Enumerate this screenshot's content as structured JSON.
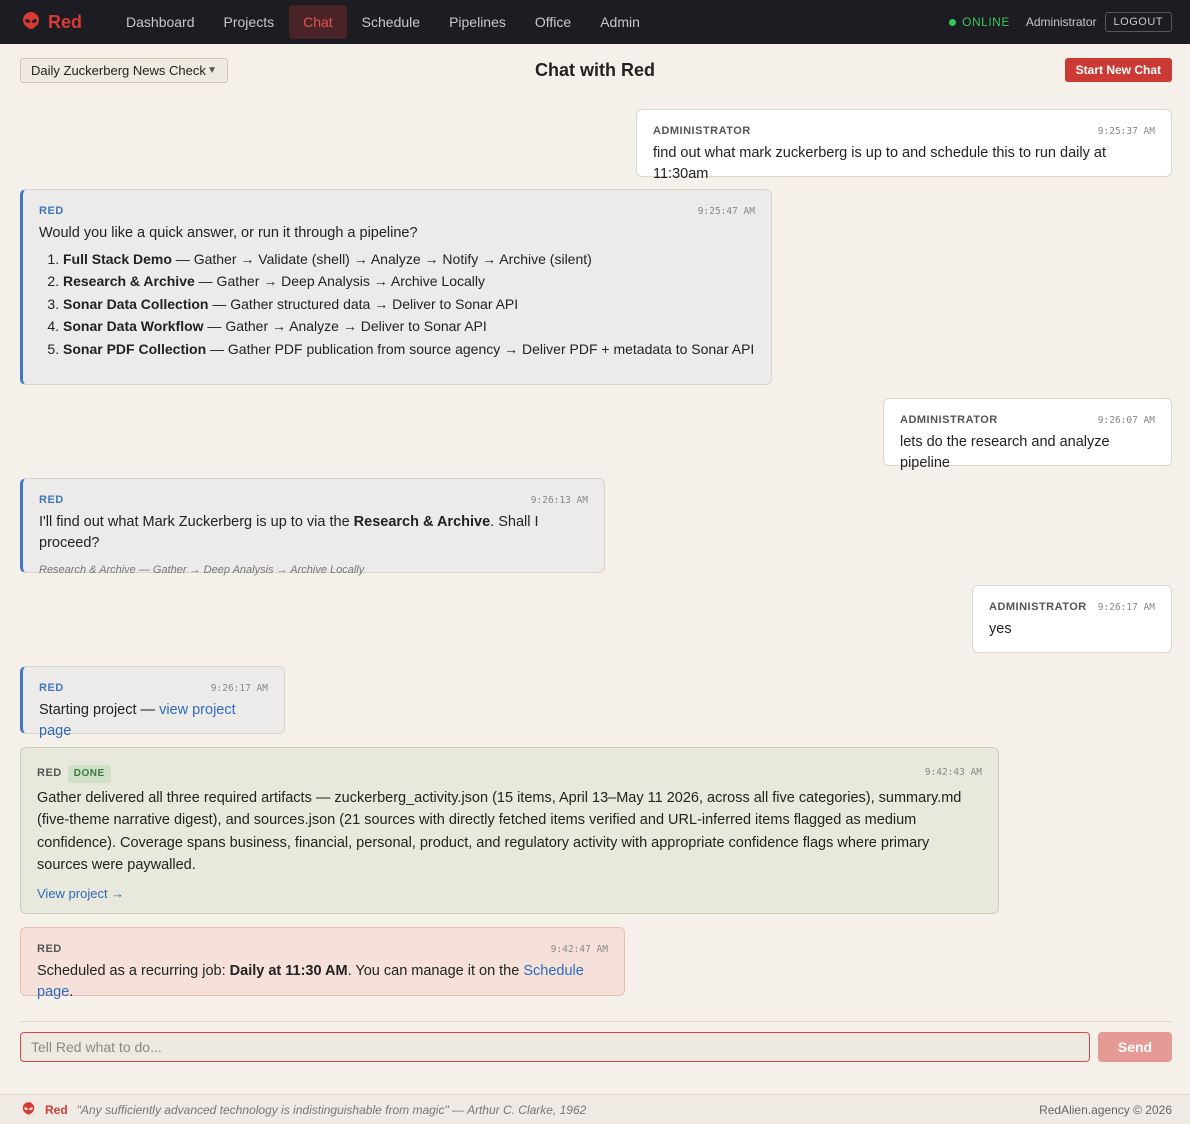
{
  "nav": {
    "brand": "Red",
    "items": [
      {
        "label": "Dashboard",
        "active": false
      },
      {
        "label": "Projects",
        "active": false
      },
      {
        "label": "Chat",
        "active": true
      },
      {
        "label": "Schedule",
        "active": false
      },
      {
        "label": "Pipelines",
        "active": false
      },
      {
        "label": "Office",
        "active": false
      },
      {
        "label": "Admin",
        "active": false
      }
    ],
    "status": "ONLINE",
    "user": "Administrator",
    "logout": "LOGOUT"
  },
  "header": {
    "chat_selector": "Daily Zuckerberg News Check",
    "title": "Chat with Red",
    "new_chat": "Start New Chat"
  },
  "messages": [
    {
      "sender": "ADMINISTRATOR",
      "time": "9:25:37 AM",
      "text": "find out what mark zuckerberg is up to and schedule this to run daily at 11:30am"
    },
    {
      "sender": "RED",
      "time": "9:25:47 AM",
      "text": "Would you like a quick answer, or run it through a pipeline?",
      "options": [
        {
          "name": "Full Stack Demo",
          "desc": " — Gather → Validate (shell) → Analyze → Notify → Archive (silent)"
        },
        {
          "name": "Research & Archive",
          "desc": " — Gather → Deep Analysis → Archive Locally"
        },
        {
          "name": "Sonar Data Collection",
          "desc": " — Gather structured data → Deliver to Sonar API"
        },
        {
          "name": "Sonar Data Workflow",
          "desc": " — Gather → Analyze → Deliver to Sonar API"
        },
        {
          "name": "Sonar PDF Collection",
          "desc": " — Gather PDF publication from source agency → Deliver PDF + metadata to Sonar API"
        }
      ]
    },
    {
      "sender": "ADMINISTRATOR",
      "time": "9:26:07 AM",
      "text": "lets do the research and analyze pipeline"
    },
    {
      "sender": "RED",
      "time": "9:26:13 AM",
      "text_before": "I'll find out what Mark Zuckerberg is up to via the ",
      "bold": "Research & Archive",
      "text_after": ". Shall I proceed?",
      "note": "Research & Archive — Gather → Deep Analysis → Archive Locally"
    },
    {
      "sender": "ADMINISTRATOR",
      "time": "9:26:17 AM",
      "text": "yes"
    },
    {
      "sender": "RED",
      "time": "9:26:17 AM",
      "text": "Starting project — ",
      "link": "view project page"
    },
    {
      "sender": "RED",
      "badge": "DONE",
      "time": "9:42:43 AM",
      "text": "Gather delivered all three required artifacts — zuckerberg_activity.json (15 items, April 13–May 11 2026, across all five categories), summary.md (five-theme narrative digest), and sources.json (21 sources with directly fetched items verified and URL-inferred items flagged as medium confidence). Coverage spans business, financial, personal, product, and regulatory activity with appropriate confidence flags where primary sources were paywalled.",
      "link": "View project →"
    },
    {
      "sender": "RED",
      "time": "9:42:47 AM",
      "text_before": "Scheduled as a recurring job: ",
      "bold": "Daily at 11:30 AM",
      "text_after": ". You can manage it on the ",
      "link": "Schedule page",
      "text_end": "."
    }
  ],
  "composer": {
    "placeholder": "Tell Red what to do...",
    "send": "Send"
  },
  "footer": {
    "brand": "Red",
    "quote": "\"Any sufficiently advanced technology is indistinguishable from magic\" — Arthur C. Clarke, 1962",
    "copyright": "RedAlien.agency © 2026"
  }
}
